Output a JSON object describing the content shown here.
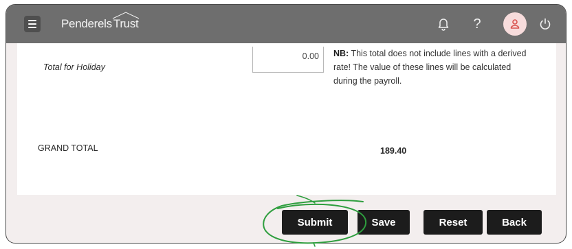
{
  "header": {
    "logo_text_1": "Penderels",
    "logo_text_2": "Trust",
    "icons": [
      "menu-icon",
      "bell-icon",
      "help-icon",
      "user-icon",
      "power-icon"
    ],
    "help_glyph": "?"
  },
  "totals": {
    "holiday_label": "Total for Holiday",
    "holiday_value": "0.00",
    "nb_bold": "NB:",
    "nb_text": " This total does not include lines with a derived rate! The value of these lines will be calculated during the payroll.",
    "grand_label": "GRAND TOTAL",
    "grand_value": "189.40"
  },
  "actions": {
    "submit": "Submit",
    "save": "Save",
    "reset": "Reset",
    "back": "Back"
  },
  "colors": {
    "header_bg": "#6e6e6e",
    "page_bg": "#f3eeee",
    "button_bg": "#1c1c1c",
    "avatar_bg": "#f7dcdc",
    "avatar_icon": "#d9534f",
    "annotation": "#2e9e3e"
  }
}
